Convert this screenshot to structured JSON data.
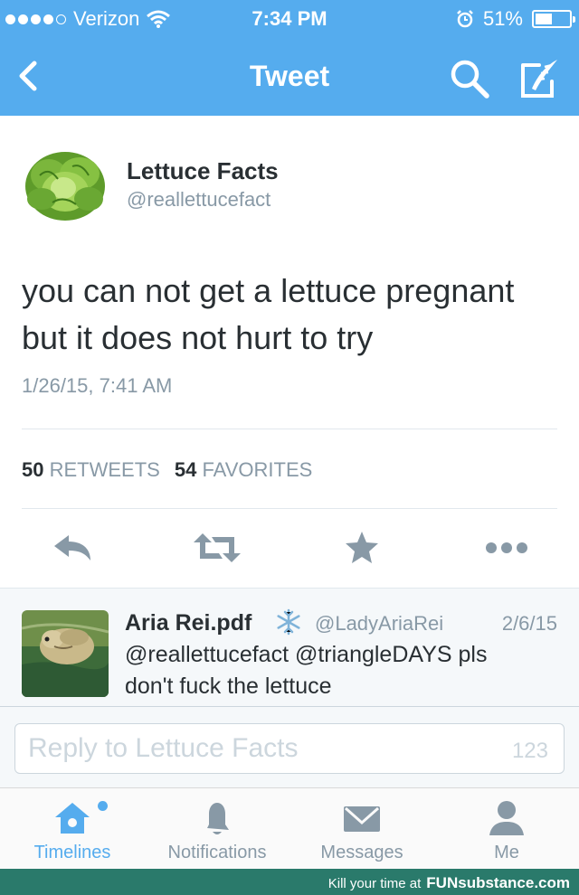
{
  "status_bar": {
    "carrier": "Verizon",
    "time": "7:34 PM",
    "battery_percent": "51%",
    "battery_level": 0.51,
    "signal_bars": 4
  },
  "nav": {
    "title": "Tweet",
    "icons": [
      "back-chevron-icon",
      "search-icon",
      "compose-icon"
    ]
  },
  "tweet": {
    "author_name": "Lettuce Facts",
    "author_handle": "@reallettucefact",
    "text_line1": "you can not get a lettuce pregnant",
    "text_line2": "but it does not hurt to try",
    "date": "1/26/15, 7:41 AM",
    "retweet_count": "50",
    "retweet_label": "RETWEETS",
    "favorite_count": "54",
    "favorite_label": "FAVORITES",
    "actions": [
      "reply-icon",
      "retweet-icon",
      "favorite-icon",
      "more-icon"
    ]
  },
  "reply": {
    "name": "Aria Rei.pdf",
    "handle": "@LadyAriaRei",
    "date": "2/6/15",
    "text_line1": "@reallettucefact @triangleDAYS pls",
    "text_line2": "don't fuck the lettuce"
  },
  "compose": {
    "placeholder": "Reply to Lettuce Facts",
    "char_count": "123"
  },
  "tabs": [
    {
      "label": "Timelines",
      "icon": "home-icon",
      "active": true
    },
    {
      "label": "Notifications",
      "icon": "bell-icon",
      "active": false
    },
    {
      "label": "Messages",
      "icon": "envelope-icon",
      "active": false
    },
    {
      "label": "Me",
      "icon": "person-icon",
      "active": false
    }
  ],
  "footer": {
    "text": "Kill your time at",
    "brand": "FUNsubstance.com"
  },
  "colors": {
    "accent": "#55acee",
    "text": "#292f33",
    "muted": "#8899a6",
    "footer_bg": "#2a7a6b"
  }
}
